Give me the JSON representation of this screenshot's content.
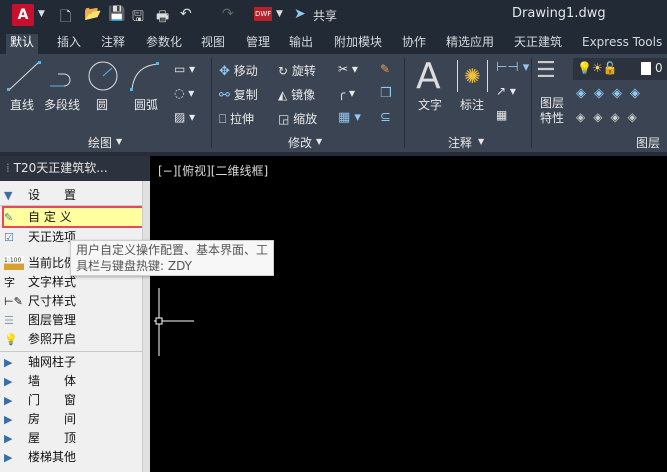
{
  "titlebar": {
    "logo": "A",
    "share": "共享",
    "filename": "Drawing1.dwg",
    "dwf": "DWF"
  },
  "tabs": [
    "默认",
    "插入",
    "注释",
    "参数化",
    "视图",
    "管理",
    "输出",
    "附加模块",
    "协作",
    "精选应用",
    "天正建筑",
    "Express Tools"
  ],
  "ribbon": {
    "draw": {
      "line": "直线",
      "polyline": "多段线",
      "circle": "圆",
      "arc": "圆弧",
      "label": "绘图"
    },
    "modify": {
      "move": "移动",
      "rotate": "旋转",
      "copy": "复制",
      "mirror": "镜像",
      "stretch": "拉伸",
      "scale": "缩放",
      "label": "修改"
    },
    "annotation": {
      "text": "文字",
      "dimension": "标注",
      "label": "注释"
    },
    "layers": {
      "properties_line1": "图层",
      "properties_line2": "特性",
      "current_layer": "0",
      "label": "图层"
    }
  },
  "panel": {
    "title": "T20天正建筑软...",
    "section": "设　　置",
    "items": [
      "自 定 义",
      "天正选项",
      "当前比例",
      "文字样式",
      "尺寸样式",
      "图层管理",
      "参照开启"
    ],
    "scale_badge": "1:100",
    "groups": [
      "轴网柱子",
      "墙　　体",
      "门　　窗",
      "房　　间",
      "屋　　顶",
      "楼梯其他"
    ]
  },
  "viewport": {
    "label": "[−][俯视][二维线框]"
  },
  "tooltip": {
    "line1": "用户自定义操作配置、基本界面、工",
    "line2": "具栏与键盘热键: ZDY"
  }
}
